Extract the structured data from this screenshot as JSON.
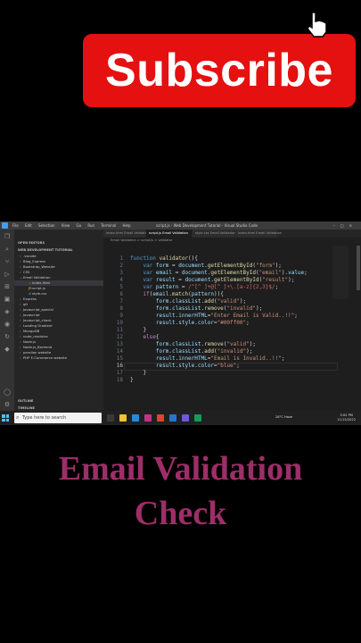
{
  "banner": {
    "label": "Subscribe"
  },
  "caption": {
    "line1": "Email Validation",
    "line2": "Check"
  },
  "window": {
    "menu": [
      "File",
      "Edit",
      "Selection",
      "View",
      "Go",
      "Run",
      "Terminal",
      "Help"
    ],
    "title": "script.js - Web Development Tutorial - Visual Studio Code"
  },
  "explorer": {
    "open_editors_header": "OPEN EDITORS",
    "project_header": "WEB DEVELOPMENT TUTORIAL",
    "items": [
      {
        "label": ".vscode"
      },
      {
        "label": "Blog_Express"
      },
      {
        "label": "Bootstrap_Website"
      },
      {
        "label": "CSS"
      },
      {
        "label": "Email Validation"
      },
      {
        "label": "index.html"
      },
      {
        "label": "script.js"
      },
      {
        "label": "style.css"
      },
      {
        "label": "Express"
      },
      {
        "label": "git"
      },
      {
        "label": "Javascript_special"
      },
      {
        "label": "Javascript"
      },
      {
        "label": "Javascript_chack"
      },
      {
        "label": "Loading Gradient"
      },
      {
        "label": "MongoDB"
      },
      {
        "label": "node_modules"
      },
      {
        "label": "Node.js"
      },
      {
        "label": "Node.js_Backend"
      },
      {
        "label": "parallax website"
      },
      {
        "label": "PHP E-Commerce website"
      }
    ],
    "outline_header": "OUTLINE",
    "timeline_header": "TIMELINE"
  },
  "tabs": [
    {
      "label": "index.html  Email Validation"
    },
    {
      "label": "script.js  Email Validation"
    },
    {
      "label": "style.css  Email Validation"
    },
    {
      "label": "index.html  Email Validation"
    }
  ],
  "breadcrumb": "Email Validation  >  script.js  >  validator",
  "statusbar": {
    "left": "⊗ 0  ⚠ 0",
    "right": "Ln 16, Col 35   Spaces: 4   UTF-8   CRLF   JavaScript   Go Live   Prettier"
  },
  "taskbar": {
    "search_placeholder": "Type here to search",
    "weather": "26°C  Haze",
    "time": "3:05 PM",
    "date": "11/15/2022"
  },
  "colors": {
    "banner": "#e51010",
    "caption": "#9c2e68",
    "statusbar": "#007acc"
  },
  "editor": {
    "current_line": 16,
    "line_numbers": [
      "1",
      "2",
      "3",
      "4",
      "5",
      "6",
      "7",
      "8",
      "9",
      "10",
      "11",
      "12",
      "13",
      "14",
      "15",
      "16",
      "17",
      "18"
    ]
  }
}
